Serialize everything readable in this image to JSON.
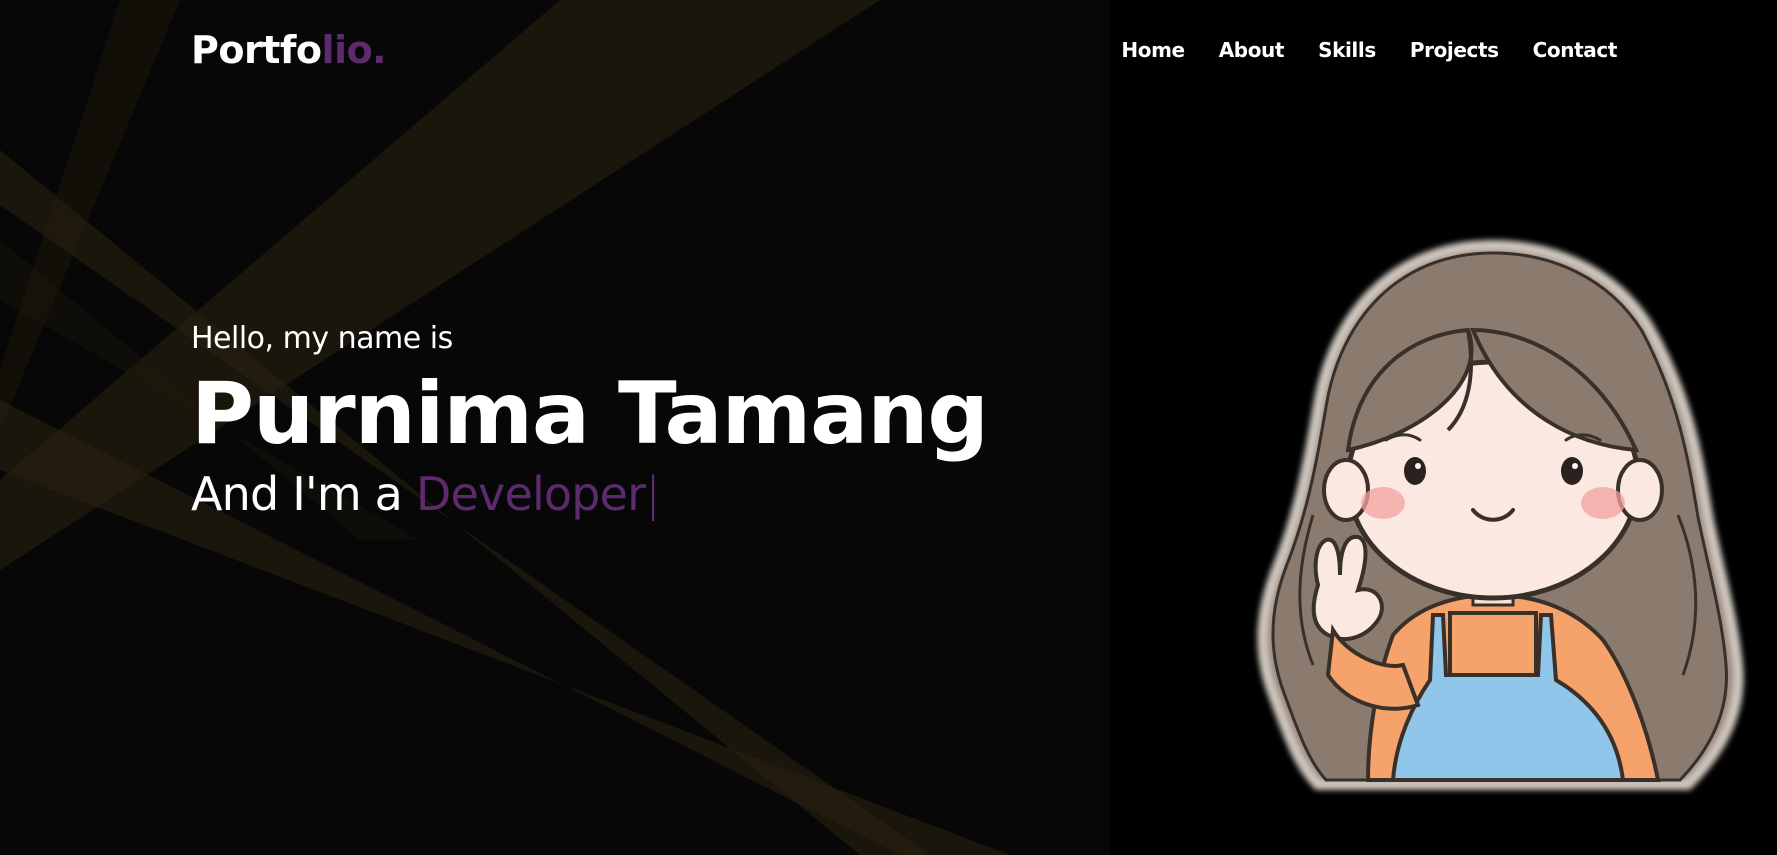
{
  "logo": {
    "main": "Portfo",
    "accent": "lio."
  },
  "nav": {
    "items": [
      "Home",
      "About",
      "Skills",
      "Projects",
      "Contact"
    ]
  },
  "hero": {
    "greeting": "Hello, my name is",
    "name": "Purnima Tamang",
    "role_prefix": "And I'm a ",
    "role": "Developer",
    "cursor": "|"
  },
  "colors": {
    "accent": "#5e2a6e",
    "background": "#070707",
    "beam": "#2a2210",
    "text": "#ffffff"
  },
  "icons": {
    "avatar": "cartoon-girl-peace-sign-avatar"
  }
}
